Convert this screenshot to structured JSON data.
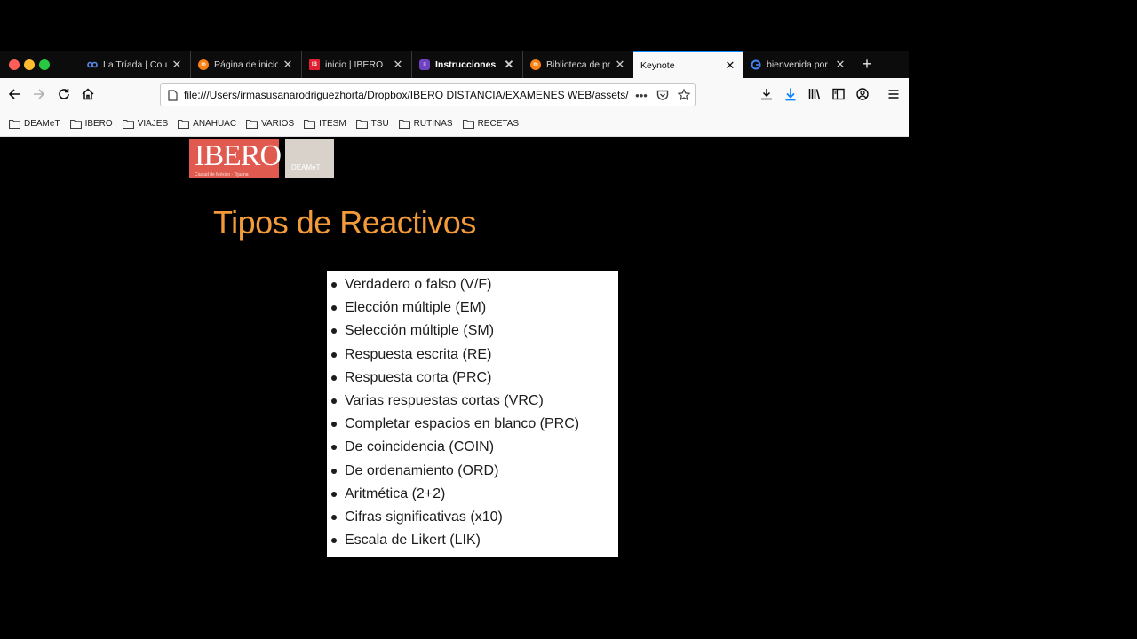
{
  "window": {
    "traffic_lights": [
      "#ff5f57",
      "#febc2e",
      "#28c840"
    ]
  },
  "tabs": [
    {
      "title": "La Tríada | Cou",
      "icon": "link-icon",
      "color": "#5b8def"
    },
    {
      "title": "Página de inicio",
      "icon": "moodle-icon",
      "color": "#f98012"
    },
    {
      "title": "inicio | IBERO",
      "icon": "ibero-icon",
      "color": "#e02030"
    },
    {
      "title": "Instrucciones",
      "icon": "doc-icon",
      "color": "#6f42c1",
      "bold": true
    },
    {
      "title": "Biblioteca de pr",
      "icon": "moodle-icon",
      "color": "#f98012"
    },
    {
      "title": "Keynote",
      "icon": "",
      "color": "",
      "active": true
    },
    {
      "title": "bienvenida por c",
      "icon": "google-icon",
      "color": "#4285f4"
    }
  ],
  "newtab_label": "+",
  "url": "file:///Users/irmasusanarodriguezhorta/Dropbox/IBERO DISTANCIA/EXAMENES WEB/assets/",
  "url_actions": [
    "more-icon",
    "pocket-icon",
    "star-icon"
  ],
  "toolbar_icons": [
    "downloads-panel-icon",
    "download-icon",
    "library-icon",
    "sidebar-icon",
    "account-icon",
    "menu-icon"
  ],
  "bookmarks": [
    "DEAMeT",
    "IBERO",
    "VIAJES",
    "ANAHUAC",
    "VARIOS",
    "ITESM",
    "TSU",
    "RUTINAS",
    "RECETAS"
  ],
  "slide": {
    "logo_text": "IBERO",
    "logo_subtext": "Ciudad de México · Tijuana",
    "badge_text": "DEAMeT",
    "title": "Tipos de Reactivos",
    "items": [
      "Verdadero o falso (V/F)",
      "Elección múltiple (EM)",
      "Selección múltiple (SM)",
      "Respuesta escrita (RE)",
      "Respuesta corta (PRC)",
      "Varias respuestas cortas (VRC)",
      "Completar espacios en blanco (PRC)",
      "De coincidencia (COIN)",
      "De ordenamiento (ORD)",
      "Aritmética (2+2)",
      "Cifras significativas (x10)",
      "Escala de Likert (LIK)"
    ]
  },
  "colors": {
    "accent": "#0a84ff",
    "title_orange": "#f39a3a",
    "ibero_red": "#e05a4f"
  }
}
